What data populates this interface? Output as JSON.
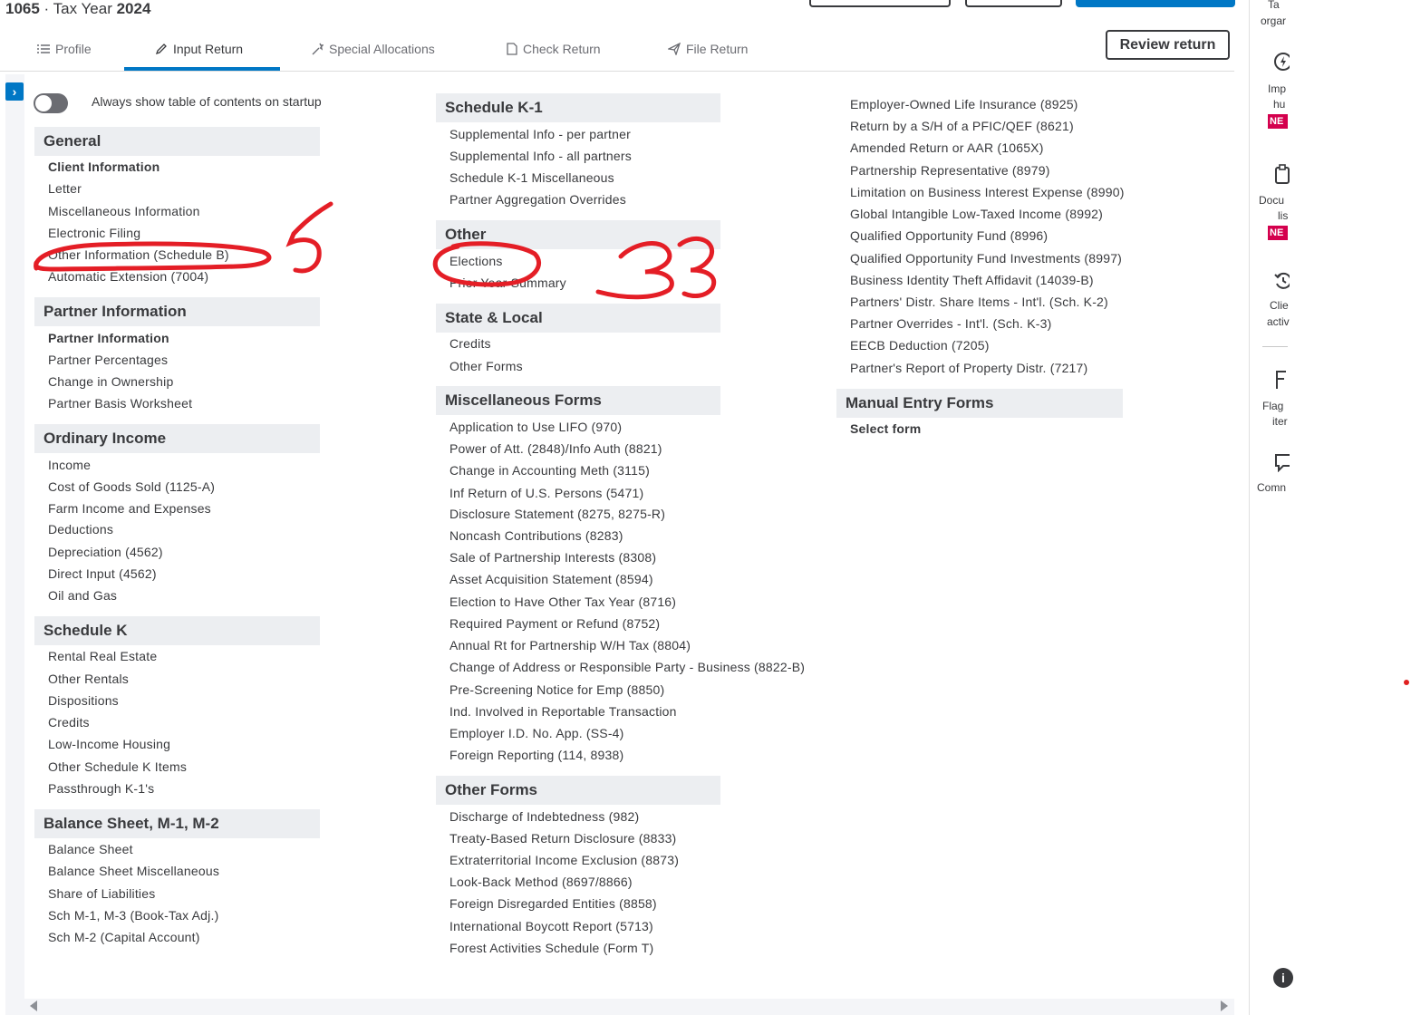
{
  "header": {
    "form": "1065",
    "separator": " · ",
    "tax_year_prefix": "Tax Year ",
    "tax_year": "2024"
  },
  "tabs": [
    {
      "label": "Profile",
      "icon": "list-icon"
    },
    {
      "label": "Input Return",
      "icon": "pencil-icon",
      "active": true
    },
    {
      "label": "Special Allocations",
      "icon": "wand-icon"
    },
    {
      "label": "Check Return",
      "icon": "document-icon"
    },
    {
      "label": "File Return",
      "icon": "paper-plane-icon"
    }
  ],
  "review_button": "Review return",
  "toc_toggle": {
    "label": "Always show table of contents on startup",
    "on": false
  },
  "col1": {
    "general": {
      "title": "General",
      "items": [
        "Client Information",
        "Letter",
        "Miscellaneous Information",
        "Electronic Filing",
        "Other Information (Schedule B)",
        "Automatic Extension (7004)"
      ]
    },
    "partner": {
      "title": "Partner Information",
      "items": [
        "Partner Information",
        "Partner Percentages",
        "Change in Ownership",
        "Partner Basis Worksheet"
      ]
    },
    "ordinary": {
      "title": "Ordinary Income",
      "items": [
        "Income",
        "Cost of Goods Sold (1125-A)",
        "Farm Income and Expenses",
        "Deductions",
        "Depreciation (4562)",
        "Direct Input (4562)",
        "Oil and Gas"
      ]
    },
    "schedk": {
      "title": "Schedule K",
      "items": [
        "Rental Real Estate",
        "Other Rentals",
        "Dispositions",
        "Credits",
        "Low-Income Housing",
        "Other Schedule K Items",
        "Passthrough K-1's"
      ]
    },
    "balance": {
      "title": "Balance Sheet, M-1, M-2",
      "items": [
        "Balance Sheet",
        "Balance Sheet Miscellaneous",
        "Share of Liabilities",
        "Sch M-1, M-3 (Book-Tax Adj.)",
        "Sch M-2 (Capital Account)"
      ]
    }
  },
  "col2": {
    "k1": {
      "title": "Schedule K-1",
      "items": [
        "Supplemental Info - per partner",
        "Supplemental Info - all partners",
        "Schedule K-1 Miscellaneous",
        "Partner Aggregation Overrides"
      ]
    },
    "other": {
      "title": "Other",
      "items": [
        "Elections",
        "Prior Year Summary"
      ]
    },
    "state": {
      "title": "State & Local",
      "items": [
        "Credits",
        "Other Forms"
      ]
    },
    "misc": {
      "title": "Miscellaneous Forms",
      "items": [
        "Application to Use LIFO (970)",
        "Power of Att. (2848)/Info Auth (8821)",
        "Change in Accounting Meth (3115)",
        "Inf Return of U.S. Persons (5471)",
        "Disclosure Statement (8275, 8275-R)",
        "Noncash Contributions (8283)",
        "Sale of Partnership Interests (8308)",
        "Asset Acquisition Statement (8594)",
        "Election to Have Other Tax Year (8716)",
        "Required Payment or Refund (8752)",
        "Annual Rt for Partnership W/H Tax (8804)",
        "Change of Address or Responsible Party - Business (8822-B)",
        "Pre-Screening Notice for Emp (8850)",
        "Ind. Involved in Reportable Transaction",
        "Employer I.D. No. App. (SS-4)",
        "Foreign Reporting (114, 8938)"
      ]
    },
    "otherforms": {
      "title": "Other Forms",
      "items": [
        "Discharge of Indebtedness (982)",
        "Treaty-Based Return Disclosure (8833)",
        "Extraterritorial Income Exclusion (8873)",
        "Look-Back Method (8697/8866)",
        "Foreign Disregarded Entities (8858)",
        "International Boycott Report (5713)",
        "Forest Activities Schedule (Form T)"
      ]
    }
  },
  "col3": {
    "forms": {
      "items": [
        "Employer-Owned Life Insurance (8925)",
        "Return by a S/H of a PFIC/QEF (8621)",
        "Amended Return or AAR (1065X)",
        "Partnership Representative (8979)",
        "Limitation on Business Interest Expense (8990)",
        "Global Intangible Low-Taxed Income (8992)",
        "Qualified Opportunity Fund (8996)",
        "Qualified Opportunity Fund Investments (8997)",
        "Business Identity Theft Affidavit (14039-B)",
        "Partners' Distr. Share Items - Int'l. (Sch. K-2)",
        "Partner Overrides - Int'l. (Sch. K-3)",
        "EECB Deduction (7205)",
        "Partner's Report of Property Distr. (7217)"
      ]
    },
    "manual": {
      "title": "Manual Entry Forms",
      "items": [
        "Select form"
      ]
    }
  },
  "right_panel": [
    {
      "text": [
        "Ta",
        "orgar"
      ],
      "icon": null,
      "badge": null
    },
    {
      "text": [
        "Imp",
        "hu"
      ],
      "icon": "lightning-icon",
      "badge": "NE"
    },
    {
      "text": [
        "Docu",
        "lis"
      ],
      "icon": "clipboard-icon",
      "badge": "NE"
    },
    {
      "text": [
        "Clie",
        "activ"
      ],
      "icon": "history-icon",
      "badge": null
    },
    {
      "text": [
        "Flag",
        "iter"
      ],
      "icon": "flag-icon",
      "badge": null
    },
    {
      "text": [
        "Comn"
      ],
      "icon": "comment-icon",
      "badge": null
    }
  ],
  "info_icon": "i",
  "annotations": {
    "mark_1": "5",
    "mark_2": "33",
    "color": "#e41e26"
  }
}
